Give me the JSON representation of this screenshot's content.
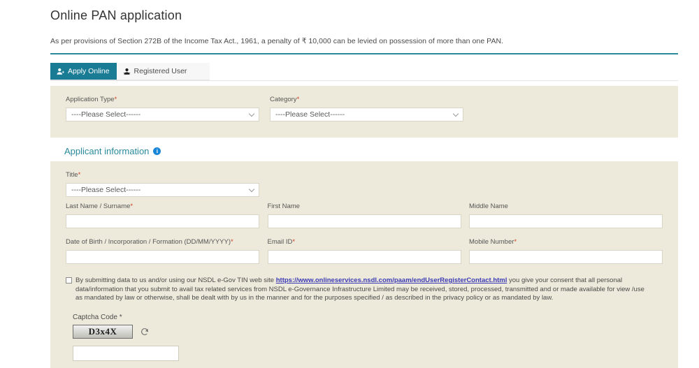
{
  "header": {
    "title": "Online PAN application",
    "notice": "As per provisions of Section 272B of the Income Tax Act., 1961, a penalty of ₹ 10,000 can be levied on possession of more than one PAN."
  },
  "tabs": [
    {
      "label": "Apply Online",
      "icon": "user-add-icon",
      "active": true
    },
    {
      "label": "Registered User",
      "icon": "user-check-icon",
      "active": false
    }
  ],
  "top_form": {
    "application_type": {
      "label": "Application Type",
      "required": "*",
      "value": "----Please Select------",
      "options": [
        "----Please Select------"
      ]
    },
    "category": {
      "label": "Category",
      "required": "*",
      "value": "----Please Select------",
      "options": [
        "----Please Select------"
      ]
    }
  },
  "applicant_section": {
    "heading": "Applicant information",
    "info_icon": "info-icon",
    "info_glyph": "i"
  },
  "applicant_form": {
    "title": {
      "label": "Title",
      "required": "*",
      "value": "----Please Select------",
      "options": [
        "----Please Select------"
      ]
    },
    "last_name": {
      "label": "Last Name / Surname",
      "required": "*",
      "value": ""
    },
    "first_name": {
      "label": "First Name",
      "required": "",
      "value": ""
    },
    "middle_name": {
      "label": "Middle Name",
      "required": "",
      "value": ""
    },
    "dob": {
      "label": "Date of Birth / Incorporation / Formation (DD/MM/YYYY)",
      "required": "*",
      "value": ""
    },
    "email": {
      "label": "Email ID",
      "required": "*",
      "value": ""
    },
    "mobile": {
      "label": "Mobile Number",
      "required": "*",
      "value": ""
    }
  },
  "consent": {
    "checked": false,
    "text_before": "By submitting data to us and/or using our NSDL e-Gov TIN web site ",
    "link_text": "https://www.onlineservices.nsdl.com/paam/endUserRegisterContact.html",
    "text_after": " you give your consent that all personal data/information that you submit to avail tax related services from NSDL e-Governance Infrastructure Limited may be received, stored, processed, transmitted and or made available for view /use as mandated by law or otherwise, shall be dealt with by us in the manner and for the purposes specified / as described in the privacy policy or as mandated by law."
  },
  "captcha": {
    "label": "Captcha Code *",
    "code": "D3x4X",
    "refresh_icon": "refresh-icon",
    "input_value": ""
  },
  "colors": {
    "accent_teal": "#1a7b95",
    "rule_teal": "#2a8a9c",
    "panel_beige": "#eeeadb",
    "link_blue": "#3a3ab5",
    "required_red": "#cc4125",
    "info_blue": "#1a86d8"
  }
}
